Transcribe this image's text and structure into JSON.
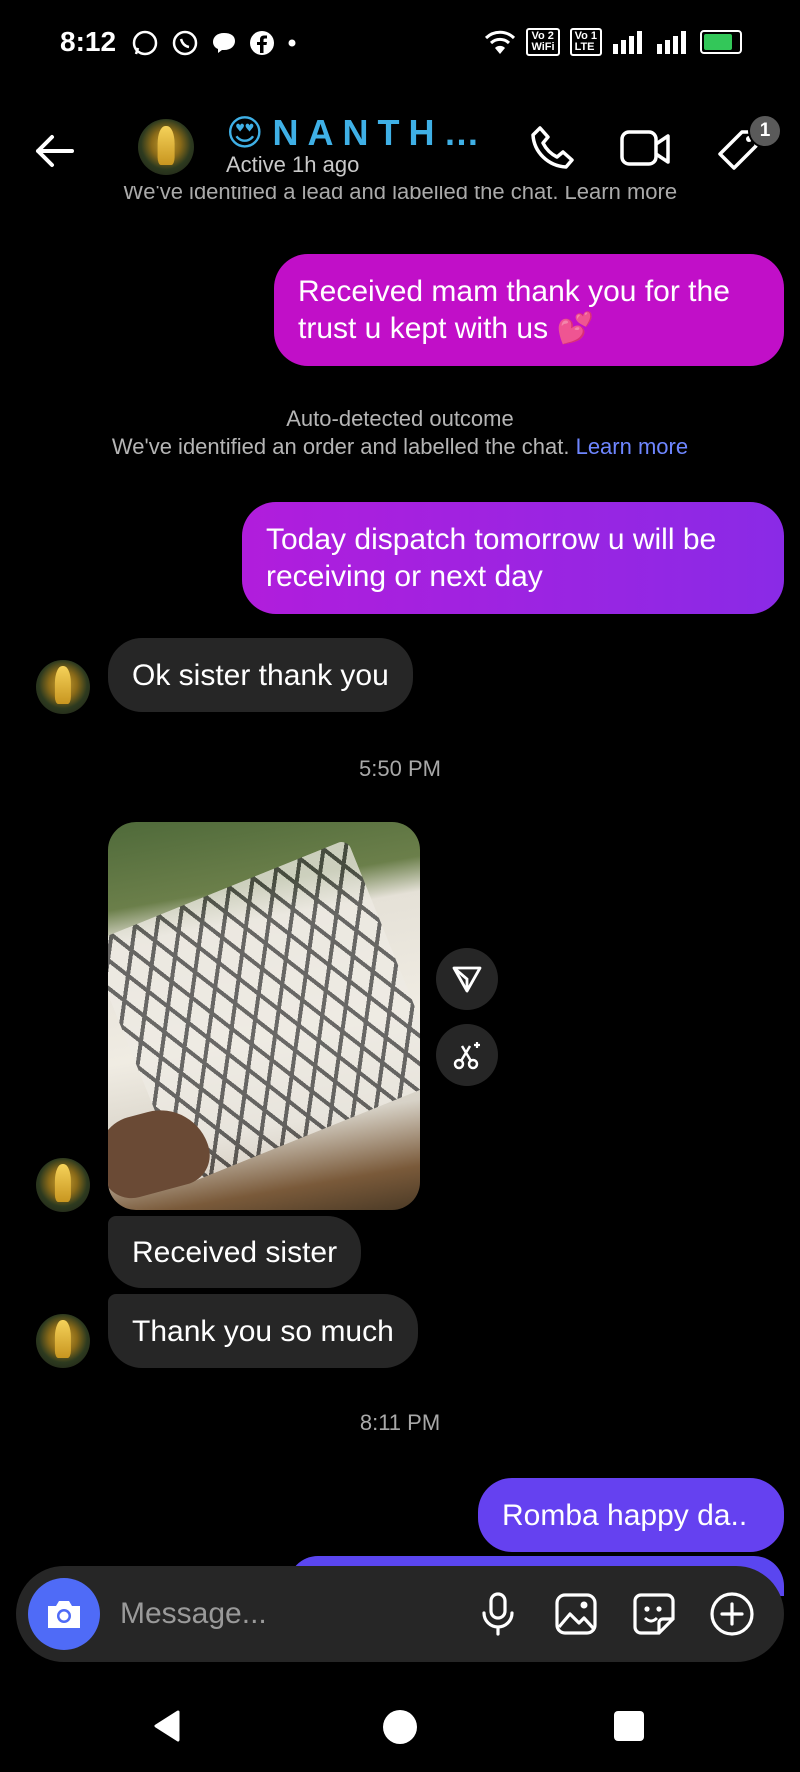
{
  "status_bar": {
    "time": "8:12",
    "vowifi_top": "Vo",
    "vowifi_num": "2",
    "vowifi_bottom": "WiFi",
    "volte_top": "Vo",
    "volte_num": "1",
    "volte_bottom": "LTE"
  },
  "header": {
    "name": "😍NANTH…",
    "status": "Active 1h ago",
    "tag_badge": "1"
  },
  "cut_hint": "We've identified a lead and labelled the chat. Learn more",
  "messages": {
    "out1": "Received mam thank you for the trust u kept with us 💕",
    "notice_title": "Auto-detected outcome",
    "notice_text": "We've identified an order and labelled the chat.",
    "notice_link": "Learn more",
    "out2": "Today dispatch tomorrow u will be receiving or next day",
    "in1": "Ok sister thank you",
    "time1": "5:50 PM",
    "in2": "Received sister",
    "in3": "Thank you so much",
    "time2": "8:11 PM",
    "out3": "Romba happy da.."
  },
  "composer": {
    "placeholder": "Message..."
  },
  "colors": {
    "pink": "#c10fc8",
    "purple": "#9b1ddc",
    "violet": "#6c3dee",
    "link": "#6e86ff",
    "camera": "#4f6bf7"
  }
}
